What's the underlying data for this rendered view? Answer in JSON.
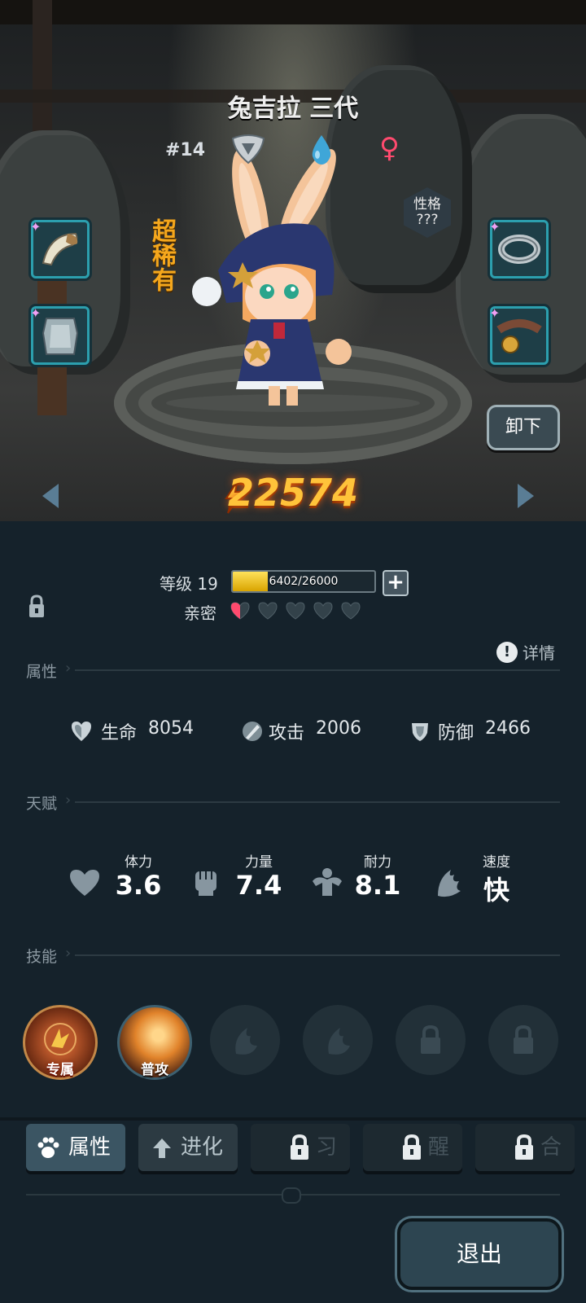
{
  "character": {
    "name": "兔吉拉 三代",
    "number": "#14",
    "rarity": "超稀有",
    "personality_label": "性格",
    "personality_value": "???",
    "gender_symbol": "♀",
    "combat_power": "22574",
    "unequip_label": "卸下"
  },
  "level": {
    "label": "等级 19",
    "xp_text": "6402/26000",
    "xp_fraction": 0.246,
    "intimacy_label": "亲密",
    "intimacy_hearts": 5,
    "intimacy_filled": 0.5
  },
  "details_label": "详情",
  "sections": {
    "attributes": "属性",
    "talents": "天赋",
    "skills": "技能"
  },
  "stats": [
    {
      "icon": "heart-shield-icon",
      "label": "生命",
      "value": "8054"
    },
    {
      "icon": "sword-icon",
      "label": "攻击",
      "value": "2006"
    },
    {
      "icon": "shield-icon",
      "label": "防御",
      "value": "2466"
    }
  ],
  "talents": [
    {
      "icon": "heart-icon",
      "label": "体力",
      "value": "3.6"
    },
    {
      "icon": "fist-icon",
      "label": "力量",
      "value": "7.4"
    },
    {
      "icon": "muscle-icon",
      "label": "耐力",
      "value": "8.1"
    },
    {
      "icon": "wing-icon",
      "label": "速度",
      "value": "快"
    }
  ],
  "skills": [
    {
      "label": "专属",
      "icon": "exclusive-skill-icon",
      "state": "active"
    },
    {
      "label": "普攻",
      "icon": "basic-attack-icon",
      "state": "active"
    },
    {
      "label": "",
      "icon": "claw-icon",
      "state": "empty"
    },
    {
      "label": "",
      "icon": "claw-icon",
      "state": "empty"
    },
    {
      "label": "",
      "icon": "lock-icon",
      "state": "locked"
    },
    {
      "label": "",
      "icon": "lock-icon",
      "state": "locked"
    }
  ],
  "tabs": [
    {
      "label": "属性",
      "icon": "paw-icon",
      "state": "active"
    },
    {
      "label": "进化",
      "icon": "arrow-up-icon",
      "state": "normal"
    },
    {
      "label": "习",
      "icon": "lock-icon",
      "state": "locked"
    },
    {
      "label": "醒",
      "icon": "lock-icon",
      "state": "locked"
    },
    {
      "label": "合",
      "icon": "lock-icon",
      "state": "locked"
    }
  ],
  "exit_label": "退出",
  "colors": {
    "accent_gold": "#ffc33a",
    "rarity_orange": "#f5a71c",
    "slot_teal": "#2c9fae",
    "gender_pink": "#ff4a6e",
    "xp_yellow": "#ffd33a",
    "panel_bg": "#15222b"
  }
}
